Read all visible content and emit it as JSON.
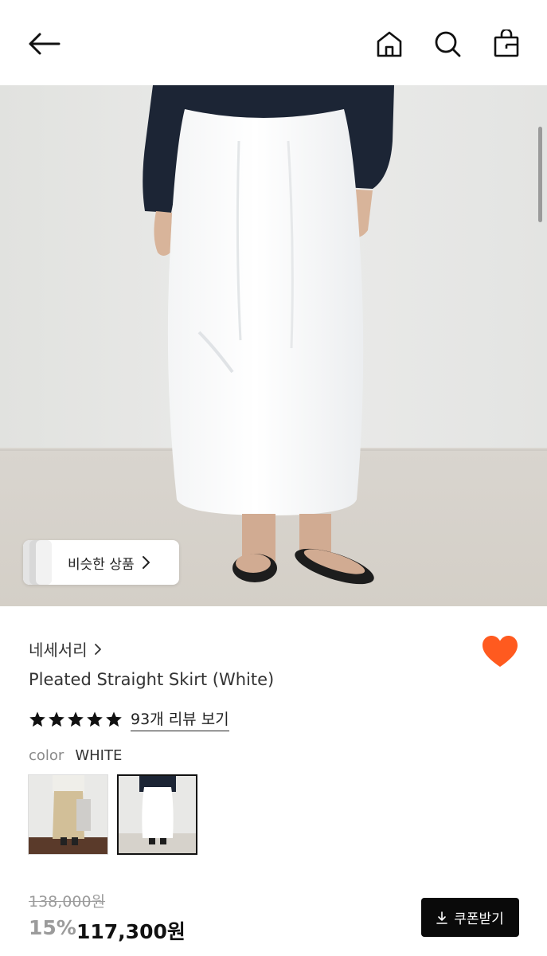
{
  "header": {
    "icons": [
      "back-arrow-icon",
      "home-icon",
      "search-icon",
      "shopping-bag-icon"
    ]
  },
  "hero": {
    "similar_label": "비슷한 상품"
  },
  "product": {
    "brand": "네세서리",
    "title": "Pleated Straight Skirt (White)",
    "rating_stars": 5,
    "reviews_label": "93개 리뷰 보기",
    "color_key": "color",
    "color_value": "WHITE",
    "wishlisted": true,
    "colors": {
      "heart": "#ff5a1f"
    }
  },
  "price": {
    "original": "138,000원",
    "discount": "15%",
    "final": "117,300원"
  },
  "coupon": {
    "label": "쿠폰받기"
  }
}
